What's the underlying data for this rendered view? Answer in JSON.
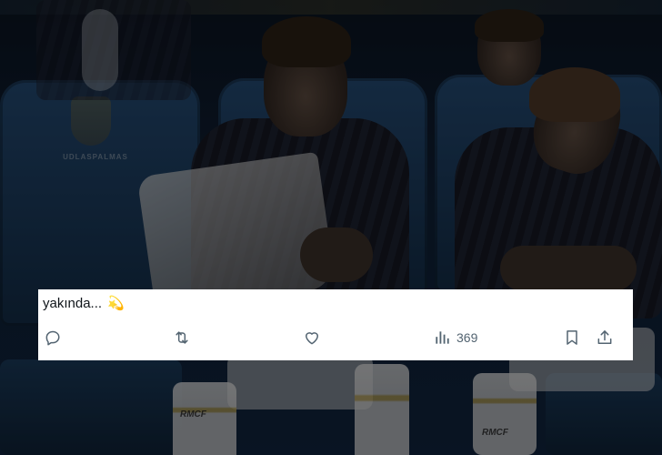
{
  "background": {
    "seat_text": "UDLASPALMAS",
    "sock_text_left": "RMCF",
    "sock_text_right": "RMCF"
  },
  "tweet": {
    "text": "yakında...",
    "emoji": "💫",
    "views": "369"
  },
  "icons": [
    "reply-icon",
    "retweet-icon",
    "like-icon",
    "views-icon",
    "bookmark-icon",
    "share-icon"
  ],
  "colors": {
    "icon": "#536471",
    "text": "#0f1419",
    "card": "#ffffff"
  }
}
